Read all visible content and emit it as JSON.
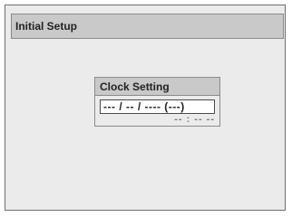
{
  "screen": {
    "title": "Initial Setup"
  },
  "dialog": {
    "title": "Clock Setting",
    "date_value": "--- / -- / ---- (---)",
    "time_value": "-- : -- --"
  }
}
